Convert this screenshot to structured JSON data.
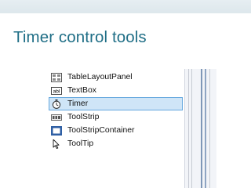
{
  "slide": {
    "title": "Timer control tools"
  },
  "toolbox": {
    "items": [
      {
        "label": "TableLayoutPanel",
        "icon": "table-layout-panel-icon",
        "selected": false
      },
      {
        "label": "TextBox",
        "icon": "textbox-icon",
        "icon_text": "abl",
        "selected": false
      },
      {
        "label": "Timer",
        "icon": "stopwatch-icon",
        "selected": true
      },
      {
        "label": "ToolStrip",
        "icon": "toolstrip-icon",
        "selected": false
      },
      {
        "label": "ToolStripContainer",
        "icon": "toolstrip-container-icon",
        "selected": false
      },
      {
        "label": "ToolTip",
        "icon": "pointer-icon",
        "selected": false
      }
    ]
  },
  "colors": {
    "title": "#1f6e86",
    "selection_fill": "#cfe5f7",
    "selection_border": "#66a8de"
  }
}
